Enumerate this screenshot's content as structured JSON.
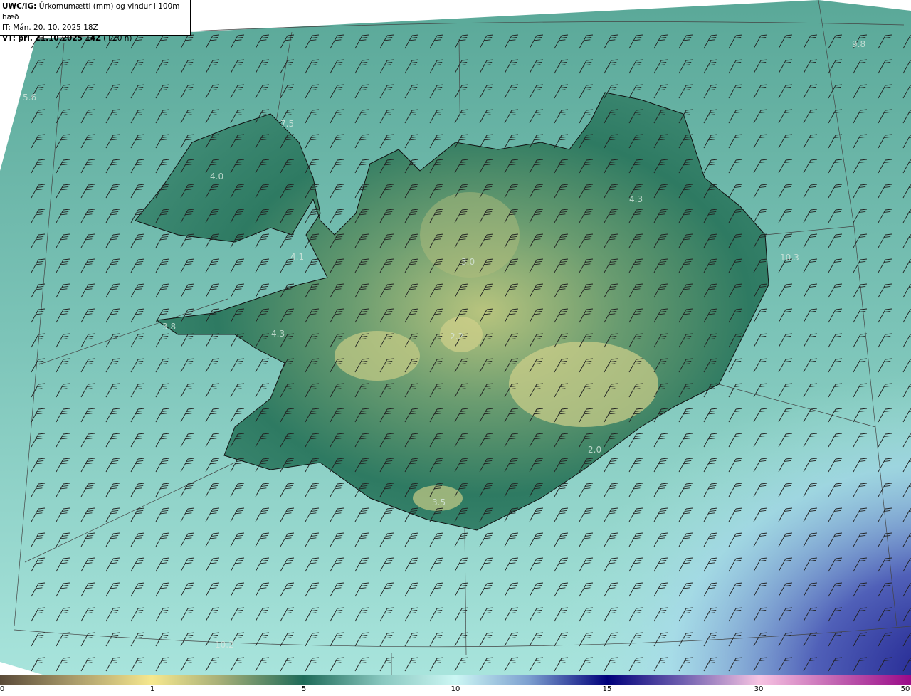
{
  "header": {
    "model": "UWC/IG:",
    "title": "Úrkomumætti (mm) og vindur i 100m hæð",
    "initial_time": "IT: Mán. 20. 10. 2025 18Z",
    "valid_label": "VT: þri. 21.10.2025 14Z",
    "lead": "(+20 h)"
  },
  "map_values": [
    {
      "id": "nw-sea",
      "text": "5.6"
    },
    {
      "id": "westfjords-n",
      "text": "7.5"
    },
    {
      "id": "westfjords",
      "text": "4.0"
    },
    {
      "id": "ne-sea",
      "text": "9.8"
    },
    {
      "id": "northeast",
      "text": "4.3"
    },
    {
      "id": "breidafjordur",
      "text": "4.1"
    },
    {
      "id": "north-central",
      "text": "3.0"
    },
    {
      "id": "east-sea",
      "text": "10.3"
    },
    {
      "id": "snaefellsnes",
      "text": "3.8"
    },
    {
      "id": "west",
      "text": "4.3"
    },
    {
      "id": "hofsjokull",
      "text": "2.2"
    },
    {
      "id": "oraefi",
      "text": "2.0"
    },
    {
      "id": "myrdalsjokull",
      "text": "3.5"
    },
    {
      "id": "south-sea",
      "text": "10.2"
    }
  ],
  "colorbar": {
    "unit": "mm",
    "ticks": [
      "0",
      "1",
      "5",
      "10",
      "15",
      "30",
      "50"
    ],
    "colors": [
      "#5a4a38",
      "#f6e88e",
      "#1e6a58",
      "#cdf7f4",
      "#00007a",
      "#f7c4e2",
      "#9a0a88"
    ]
  }
}
